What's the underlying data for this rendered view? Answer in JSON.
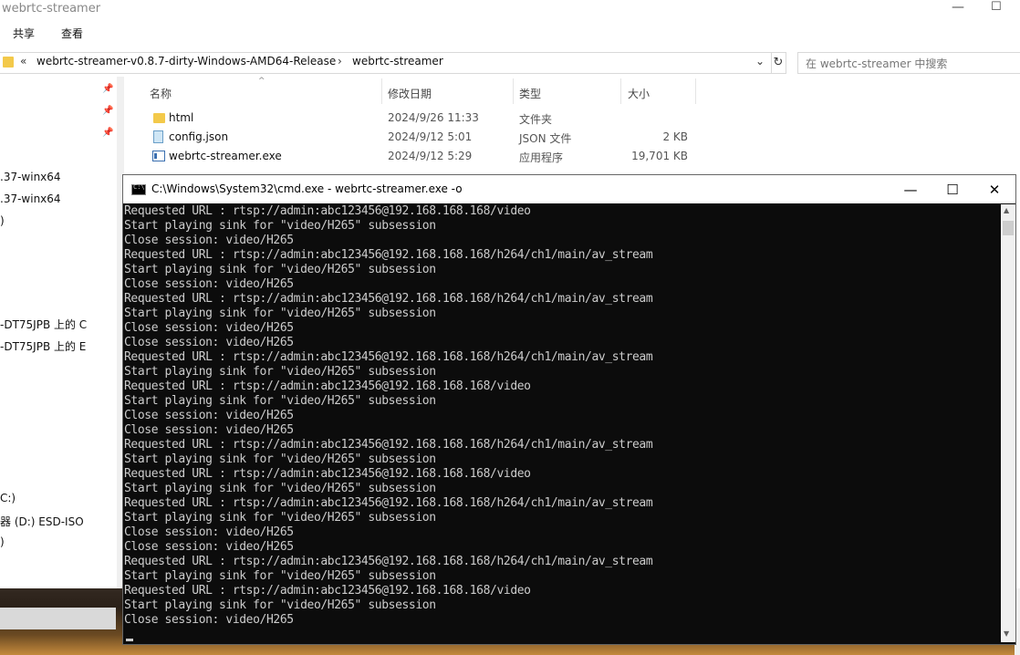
{
  "explorer": {
    "title": "webrtc-streamer",
    "min_glyph": "—",
    "max_glyph": "☐",
    "ribbon": [
      "共享",
      "查看"
    ],
    "address": {
      "chevron": "«",
      "crumbs": [
        "webrtc-streamer-v0.8.7-dirty-Windows-AMD64-Release",
        "webrtc-streamer"
      ],
      "separator": "›",
      "dropdown": "⌄",
      "refresh": "↻"
    },
    "search_placeholder": "在 webrtc-streamer 中搜索",
    "nav_items": [
      ".37-winx64",
      ".37-winx64",
      ")",
      "-DT75JPB 上的 C",
      "-DT75JPB 上的 E",
      "C:)",
      "器 (D:) ESD-ISO",
      ")"
    ],
    "columns": [
      "名称",
      "修改日期",
      "类型",
      "大小"
    ],
    "files": [
      {
        "name": "html",
        "date": "2024/9/26 11:33",
        "type": "文件夹",
        "size": ""
      },
      {
        "name": "config.json",
        "date": "2024/9/12 5:01",
        "type": "JSON 文件",
        "size": "2 KB"
      },
      {
        "name": "webrtc-streamer.exe",
        "date": "2024/9/12 5:29",
        "type": "应用程序",
        "size": "19,701 KB"
      }
    ]
  },
  "cmd": {
    "title": "C:\\Windows\\System32\\cmd.exe - webrtc-streamer.exe  -o",
    "icon_text": "C:\\",
    "buttons": {
      "minimize": "—",
      "maximize": "☐",
      "close": "✕"
    },
    "lines": [
      "Requested URL : rtsp://admin:abc123456@192.168.168.168/video",
      "Start playing sink for \"video/H265\" subsession",
      "Close session: video/H265",
      "Requested URL : rtsp://admin:abc123456@192.168.168.168/h264/ch1/main/av_stream",
      "Start playing sink for \"video/H265\" subsession",
      "Close session: video/H265",
      "Requested URL : rtsp://admin:abc123456@192.168.168.168/h264/ch1/main/av_stream",
      "Start playing sink for \"video/H265\" subsession",
      "Close session: video/H265",
      "Close session: video/H265",
      "Requested URL : rtsp://admin:abc123456@192.168.168.168/h264/ch1/main/av_stream",
      "Start playing sink for \"video/H265\" subsession",
      "Requested URL : rtsp://admin:abc123456@192.168.168.168/video",
      "Start playing sink for \"video/H265\" subsession",
      "Close session: video/H265",
      "Close session: video/H265",
      "Requested URL : rtsp://admin:abc123456@192.168.168.168/h264/ch1/main/av_stream",
      "Start playing sink for \"video/H265\" subsession",
      "Requested URL : rtsp://admin:abc123456@192.168.168.168/video",
      "Start playing sink for \"video/H265\" subsession",
      "Requested URL : rtsp://admin:abc123456@192.168.168.168/h264/ch1/main/av_stream",
      "Start playing sink for \"video/H265\" subsession",
      "Close session: video/H265",
      "Close session: video/H265",
      "Requested URL : rtsp://admin:abc123456@192.168.168.168/h264/ch1/main/av_stream",
      "Start playing sink for \"video/H265\" subsession",
      "Requested URL : rtsp://admin:abc123456@192.168.168.168/video",
      "Start playing sink for \"video/H265\" subsession",
      "Close session: video/H265"
    ]
  },
  "icons": {
    "pin": "📌",
    "sort_up": "^",
    "scroll_up": "▲",
    "scroll_down": "▼"
  }
}
